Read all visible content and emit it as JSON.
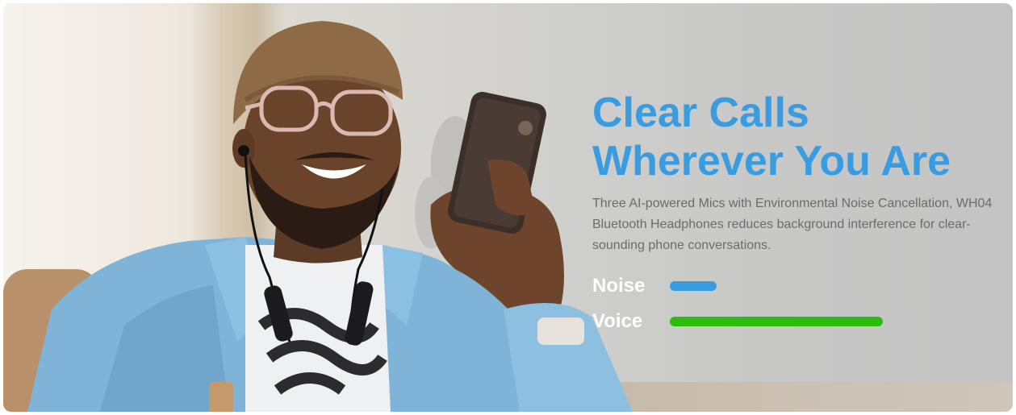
{
  "banner": {
    "headline_line1": "Clear Calls",
    "headline_line2": "Wherever You Are",
    "description": "Three AI-powered Mics with Environmental Noise Cancellation, WH04 Bluetooth Headphones reduces background interference for clear-sounding phone conversations.",
    "headline_color": "#3a9ce0"
  },
  "levels": [
    {
      "label": "Noise",
      "fraction": 0.22,
      "color": "#3a9ce0"
    },
    {
      "label": "Voice",
      "fraction": 1.0,
      "color": "#2cbc0e"
    }
  ],
  "photo": {
    "subject": "smiling-man-with-phone",
    "icons": [
      "neckband-headphones-icon",
      "smartphone-icon"
    ]
  }
}
